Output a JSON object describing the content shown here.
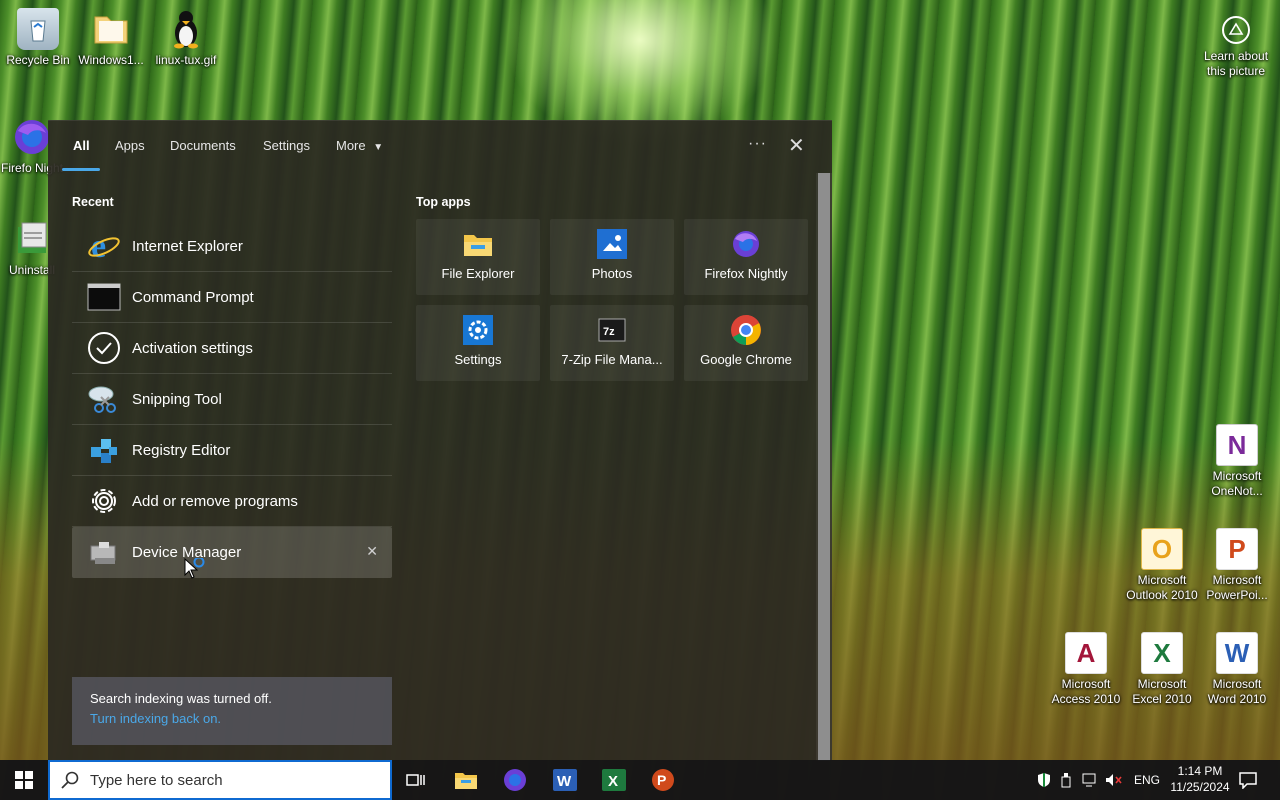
{
  "desktop": {
    "top_icons": [
      {
        "label": "Recycle Bin",
        "icon": "recycle-bin-icon"
      },
      {
        "label": "Windows1...",
        "icon": "folder-icon"
      },
      {
        "label": "linux-tux.gif",
        "icon": "tux-penguin-icon"
      }
    ],
    "left_icons": [
      {
        "label": "Firefo Night",
        "icon": "firefox-nightly-icon"
      },
      {
        "label": "Uninstall",
        "icon": "uninstall-icon"
      }
    ],
    "learn": {
      "label": "Learn about this picture",
      "icon": "camera-circle-icon"
    },
    "right_icons": [
      {
        "label": "Microsoft OneNot...",
        "icon": "onenote-icon",
        "glyph": "N",
        "color": "#7b2a9a"
      },
      {
        "label": "Microsoft Outlook 2010",
        "icon": "outlook-icon",
        "glyph": "O",
        "color": "#e8a21b"
      },
      {
        "label": "Microsoft PowerPoi...",
        "icon": "powerpoint-icon",
        "glyph": "P",
        "color": "#d04a1c"
      },
      {
        "label": "Microsoft Access 2010",
        "icon": "access-icon",
        "glyph": "A",
        "color": "#a3163a"
      },
      {
        "label": "Microsoft Excel 2010",
        "icon": "excel-icon",
        "glyph": "X",
        "color": "#1e7a3e"
      },
      {
        "label": "Microsoft Word 2010",
        "icon": "word-icon",
        "glyph": "W",
        "color": "#2b5fb5"
      }
    ]
  },
  "panel": {
    "tabs": [
      "All",
      "Apps",
      "Documents",
      "Settings",
      "More"
    ],
    "more_caret": "▼",
    "dots": "···",
    "close": "✕",
    "recent_title": "Recent",
    "recent": [
      {
        "label": "Internet Explorer",
        "icon": "internet-explorer-icon"
      },
      {
        "label": "Command Prompt",
        "icon": "command-prompt-icon"
      },
      {
        "label": "Activation settings",
        "icon": "checkmark-circle-icon"
      },
      {
        "label": "Snipping Tool",
        "icon": "scissors-icon"
      },
      {
        "label": "Registry Editor",
        "icon": "registry-icon"
      },
      {
        "label": "Add or remove programs",
        "icon": "gear-icon"
      },
      {
        "label": "Device Manager",
        "icon": "device-manager-icon"
      }
    ],
    "top_apps_title": "Top apps",
    "top_apps": [
      {
        "label": "File Explorer",
        "icon": "file-explorer-icon"
      },
      {
        "label": "Photos",
        "icon": "photos-icon"
      },
      {
        "label": "Firefox Nightly",
        "icon": "firefox-nightly-icon"
      },
      {
        "label": "Settings",
        "icon": "settings-gear-icon"
      },
      {
        "label": "7-Zip File Mana...",
        "icon": "seven-zip-icon"
      },
      {
        "label": "Google Chrome",
        "icon": "chrome-icon"
      }
    ],
    "notice": {
      "text": "Search indexing was turned off.",
      "link": "Turn indexing back on."
    }
  },
  "taskbar": {
    "search_placeholder": "Type here to search",
    "lang": "ENG",
    "time": "1:14 PM",
    "date": "11/25/2024"
  }
}
